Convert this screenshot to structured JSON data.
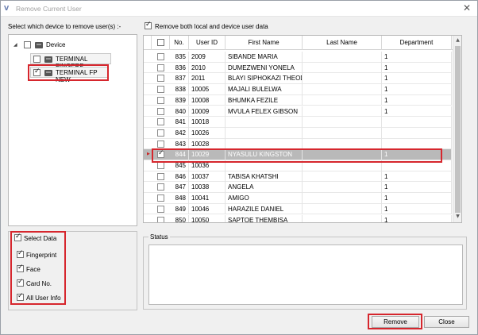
{
  "window": {
    "title": "Remove Current User",
    "app_icon": "V"
  },
  "left": {
    "heading": "Select which device to remove user(s) :-",
    "tree": {
      "root_label": "Device",
      "devices": [
        {
          "label": "TERMINAL FINGERP",
          "checked": false
        },
        {
          "label": "TERMINAL FP NEW",
          "checked": true
        }
      ]
    }
  },
  "top_option": {
    "label": "Remove both local and device user data",
    "checked": true
  },
  "grid": {
    "columns": [
      "No.",
      "User ID",
      "First Name",
      "Last Name",
      "Department"
    ],
    "rows": [
      {
        "no": "835",
        "id": "2009",
        "first": "SIBANDE MARIA",
        "last": "",
        "dept": "1",
        "checked": false
      },
      {
        "no": "836",
        "id": "2010",
        "first": "DUMEZWENI YONELA",
        "last": "",
        "dept": "1",
        "checked": false
      },
      {
        "no": "837",
        "id": "2011",
        "first": "BLAYI SIPHOKAZI THEOD...",
        "last": "",
        "dept": "1",
        "checked": false
      },
      {
        "no": "838",
        "id": "10005",
        "first": "MAJALI BULELWA",
        "last": "",
        "dept": "1",
        "checked": false
      },
      {
        "no": "839",
        "id": "10008",
        "first": "BHUMKA FEZILE",
        "last": "",
        "dept": "1",
        "checked": false
      },
      {
        "no": "840",
        "id": "10009",
        "first": "MVULA FELEX GIBSON",
        "last": "",
        "dept": "1",
        "checked": false
      },
      {
        "no": "841",
        "id": "10018",
        "first": "",
        "last": "",
        "dept": "",
        "checked": false
      },
      {
        "no": "842",
        "id": "10026",
        "first": "",
        "last": "",
        "dept": "",
        "checked": false
      },
      {
        "no": "843",
        "id": "10028",
        "first": "",
        "last": "",
        "dept": "",
        "checked": false
      },
      {
        "no": "844",
        "id": "10029",
        "first": "NYASULU KINGSTON",
        "last": "",
        "dept": "1",
        "checked": true,
        "selected": true
      },
      {
        "no": "845",
        "id": "10036",
        "first": "",
        "last": "",
        "dept": "",
        "checked": false
      },
      {
        "no": "846",
        "id": "10037",
        "first": "TABISA KHATSHI",
        "last": "",
        "dept": "1",
        "checked": false
      },
      {
        "no": "847",
        "id": "10038",
        "first": "ANGELA",
        "last": "",
        "dept": "1",
        "checked": false
      },
      {
        "no": "848",
        "id": "10041",
        "first": "AMIGO",
        "last": "",
        "dept": "1",
        "checked": false
      },
      {
        "no": "849",
        "id": "10046",
        "first": "HARAZILE DANIEL",
        "last": "",
        "dept": "1",
        "checked": false
      },
      {
        "no": "850",
        "id": "10050",
        "first": "SAPTOE THEMBISA",
        "last": "",
        "dept": "1",
        "checked": false
      }
    ]
  },
  "select_data": {
    "label": "Select Data",
    "checked": true,
    "options": [
      {
        "label": "Fingerprint",
        "checked": true
      },
      {
        "label": "Face",
        "checked": true
      },
      {
        "label": "Card No.",
        "checked": true
      },
      {
        "label": "All User Info",
        "checked": true
      }
    ]
  },
  "status": {
    "label": "Status",
    "text": ""
  },
  "buttons": {
    "remove": "Remove",
    "close": "Close"
  },
  "colors": {
    "highlight": "#d6262d",
    "selected_row": "#b9b9b9"
  }
}
